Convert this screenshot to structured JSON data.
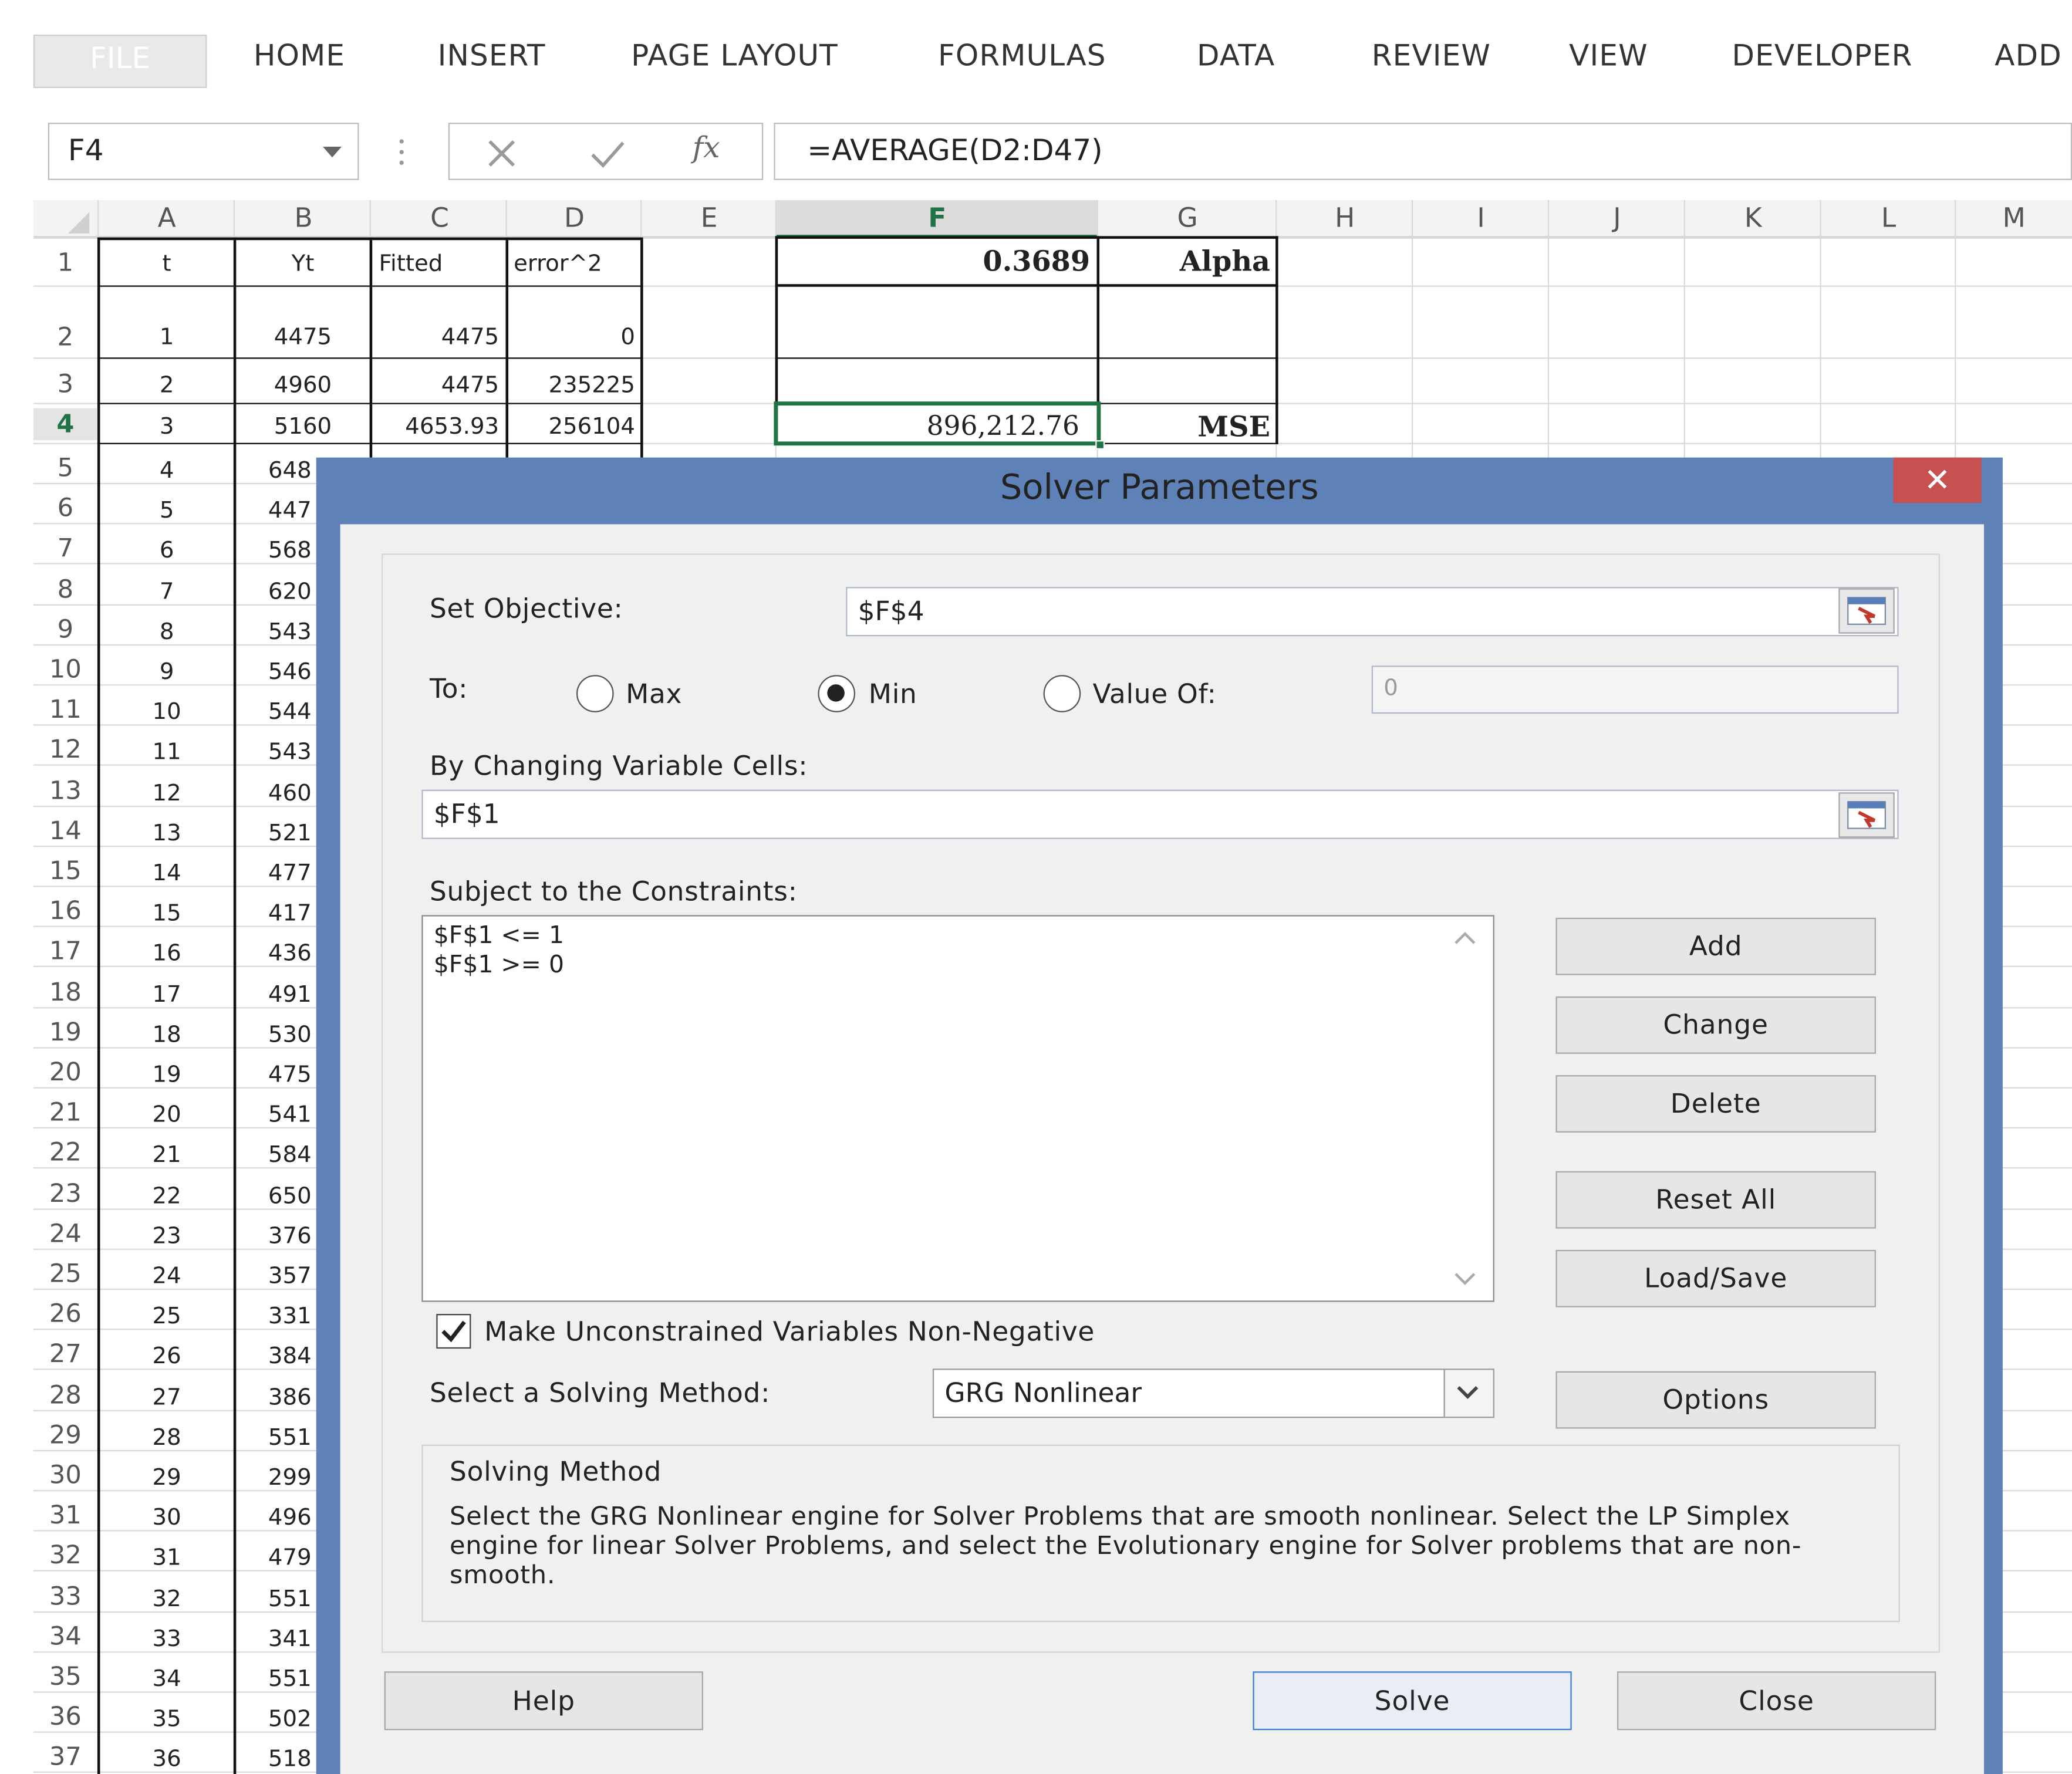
{
  "ribbon": {
    "tabs": [
      "FILE",
      "HOME",
      "INSERT",
      "PAGE LAYOUT",
      "FORMULAS",
      "DATA",
      "REVIEW",
      "VIEW",
      "DEVELOPER",
      "ADD"
    ]
  },
  "formula_bar": {
    "name_box": "F4",
    "fx_symbol": "fx",
    "formula": "=AVERAGE(D2:D47)"
  },
  "grid": {
    "columns": [
      "A",
      "B",
      "C",
      "D",
      "E",
      "F",
      "G",
      "H",
      "I",
      "J",
      "K",
      "L",
      "M"
    ],
    "headers_row": {
      "t": "t",
      "yt": "Yt",
      "fitted": "Fitted",
      "error": "error^2"
    },
    "row2": {
      "t": "1",
      "yt": "4475",
      "fitted": "4475",
      "error": "0"
    },
    "row3": {
      "t": "2",
      "yt": "4960",
      "fitted": "4475",
      "error": "235225"
    },
    "row4": {
      "t": "3",
      "yt": "5160",
      "fitted": "4653.93",
      "error": "256104"
    },
    "partial_rows": [
      {
        "n": "5",
        "t": "4",
        "yt": "648"
      },
      {
        "n": "6",
        "t": "5",
        "yt": "447"
      },
      {
        "n": "7",
        "t": "6",
        "yt": "568"
      },
      {
        "n": "8",
        "t": "7",
        "yt": "620"
      },
      {
        "n": "9",
        "t": "8",
        "yt": "543"
      },
      {
        "n": "10",
        "t": "9",
        "yt": "546"
      },
      {
        "n": "11",
        "t": "10",
        "yt": "544"
      },
      {
        "n": "12",
        "t": "11",
        "yt": "543"
      },
      {
        "n": "13",
        "t": "12",
        "yt": "460"
      },
      {
        "n": "14",
        "t": "13",
        "yt": "521"
      },
      {
        "n": "15",
        "t": "14",
        "yt": "477"
      },
      {
        "n": "16",
        "t": "15",
        "yt": "417"
      },
      {
        "n": "17",
        "t": "16",
        "yt": "436"
      },
      {
        "n": "18",
        "t": "17",
        "yt": "491"
      },
      {
        "n": "19",
        "t": "18",
        "yt": "530"
      },
      {
        "n": "20",
        "t": "19",
        "yt": "475"
      },
      {
        "n": "21",
        "t": "20",
        "yt": "541"
      },
      {
        "n": "22",
        "t": "21",
        "yt": "584"
      },
      {
        "n": "23",
        "t": "22",
        "yt": "650"
      },
      {
        "n": "24",
        "t": "23",
        "yt": "376"
      },
      {
        "n": "25",
        "t": "24",
        "yt": "357"
      },
      {
        "n": "26",
        "t": "25",
        "yt": "331"
      },
      {
        "n": "27",
        "t": "26",
        "yt": "384"
      },
      {
        "n": "28",
        "t": "27",
        "yt": "386"
      },
      {
        "n": "29",
        "t": "28",
        "yt": "551"
      },
      {
        "n": "30",
        "t": "29",
        "yt": "299"
      },
      {
        "n": "31",
        "t": "30",
        "yt": "496"
      },
      {
        "n": "32",
        "t": "31",
        "yt": "479"
      },
      {
        "n": "33",
        "t": "32",
        "yt": "551"
      },
      {
        "n": "34",
        "t": "33",
        "yt": "341"
      },
      {
        "n": "35",
        "t": "34",
        "yt": "551"
      },
      {
        "n": "36",
        "t": "35",
        "yt": "502"
      },
      {
        "n": "37",
        "t": "36",
        "yt": "518"
      }
    ],
    "f1": "0.3689",
    "g1": "Alpha",
    "f4": "896,212.76",
    "g4": "MSE"
  },
  "dialog": {
    "title": "Solver Parameters",
    "close_glyph": "✕",
    "set_objective_label": "Set Objective:",
    "set_objective_value": "$F$4",
    "to_label": "To:",
    "max_label": "Max",
    "min_label": "Min",
    "value_of_label": "Value Of:",
    "value_of_value": "0",
    "selected_target": "Min",
    "changing_label": "By Changing Variable Cells:",
    "changing_value": "$F$1",
    "constraints_label": "Subject to the Constraints:",
    "constraints": [
      "$F$1 <= 1",
      "$F$1 >= 0"
    ],
    "buttons": {
      "add": "Add",
      "change": "Change",
      "delete": "Delete",
      "reset_all": "Reset All",
      "load_save": "Load/Save",
      "options": "Options",
      "help": "Help",
      "solve": "Solve",
      "close": "Close"
    },
    "nonneg_label": "Make Unconstrained Variables Non-Negative",
    "nonneg_checked": true,
    "method_label": "Select a Solving Method:",
    "method_value": "GRG Nonlinear",
    "method_group_title": "Solving Method",
    "method_description": "Select the GRG Nonlinear engine for Solver Problems that are smooth nonlinear. Select the LP Simplex engine for linear Solver Problems, and select the Evolutionary engine for Solver problems that are non-smooth."
  }
}
